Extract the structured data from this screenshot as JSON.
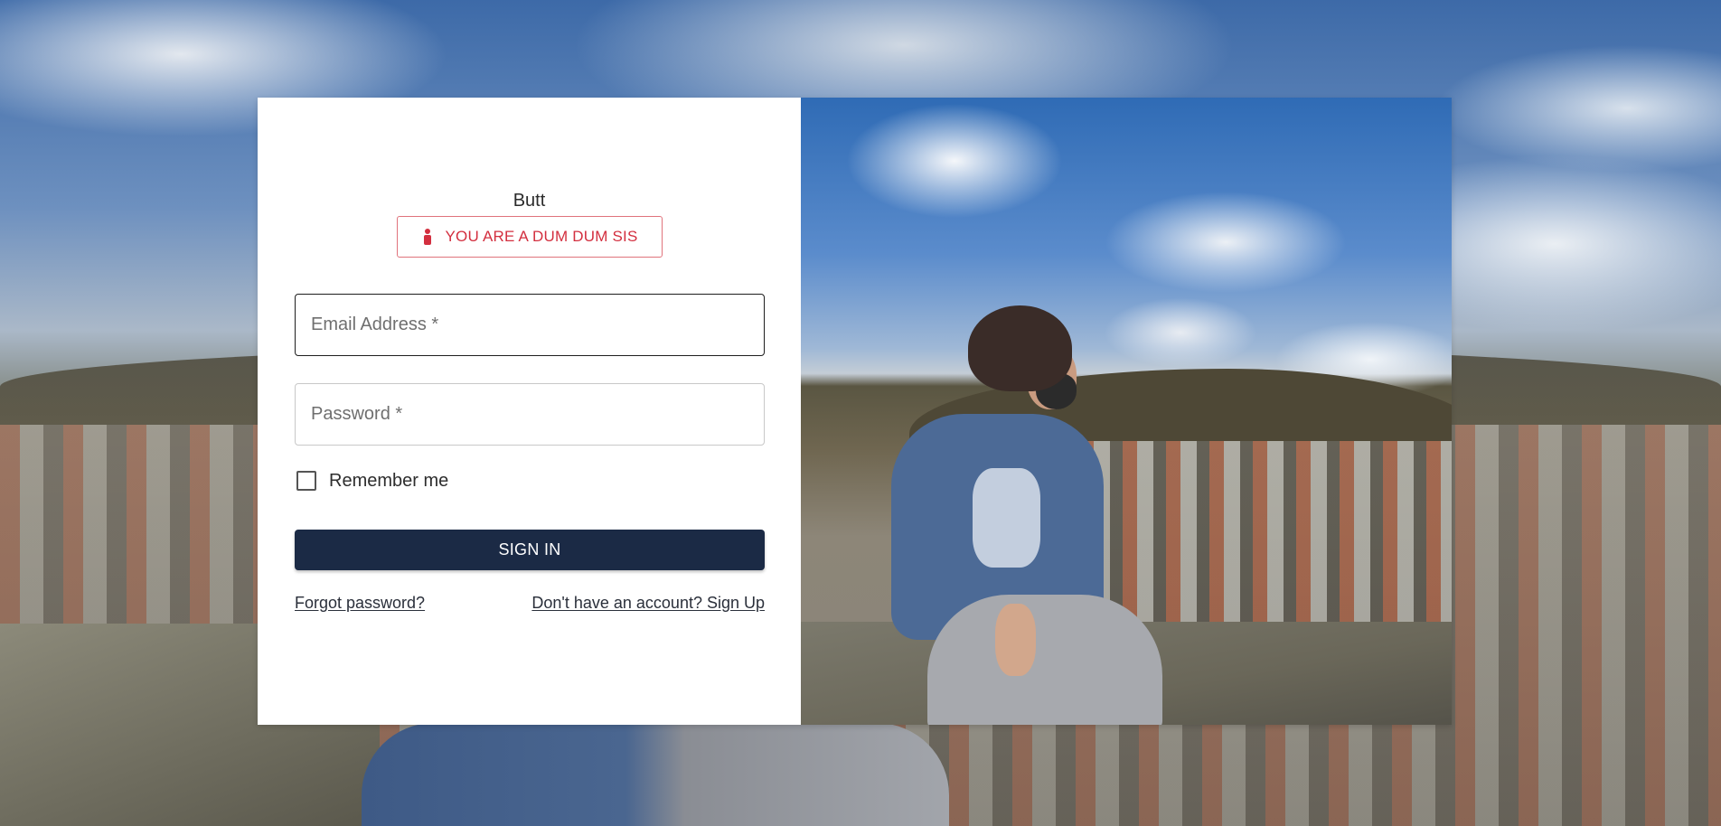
{
  "app": {
    "title": "Butt"
  },
  "alert": {
    "icon": "person-icon",
    "message": "YOU ARE A DUM DUM SIS",
    "color": "#d32f3f"
  },
  "form": {
    "email": {
      "placeholder": "Email Address *",
      "value": ""
    },
    "password": {
      "placeholder": "Password *",
      "value": ""
    },
    "remember": {
      "label": "Remember me",
      "checked": false
    },
    "submit_label": "SIGN IN",
    "submit_color": "#1b2a45"
  },
  "links": {
    "forgot_password": "Forgot password?",
    "sign_up": "Don't have an account? Sign Up"
  }
}
